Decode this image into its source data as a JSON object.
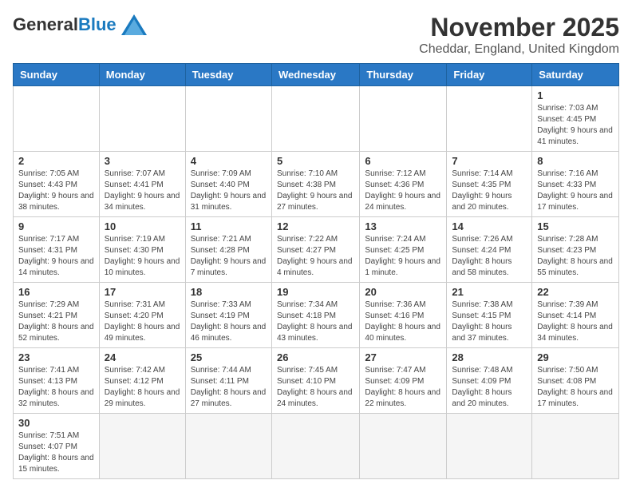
{
  "header": {
    "logo_general": "General",
    "logo_blue": "Blue",
    "month_title": "November 2025",
    "location": "Cheddar, England, United Kingdom"
  },
  "weekdays": [
    "Sunday",
    "Monday",
    "Tuesday",
    "Wednesday",
    "Thursday",
    "Friday",
    "Saturday"
  ],
  "weeks": [
    [
      {
        "day": "",
        "info": ""
      },
      {
        "day": "",
        "info": ""
      },
      {
        "day": "",
        "info": ""
      },
      {
        "day": "",
        "info": ""
      },
      {
        "day": "",
        "info": ""
      },
      {
        "day": "",
        "info": ""
      },
      {
        "day": "1",
        "info": "Sunrise: 7:03 AM\nSunset: 4:45 PM\nDaylight: 9 hours and 41 minutes."
      }
    ],
    [
      {
        "day": "2",
        "info": "Sunrise: 7:05 AM\nSunset: 4:43 PM\nDaylight: 9 hours and 38 minutes."
      },
      {
        "day": "3",
        "info": "Sunrise: 7:07 AM\nSunset: 4:41 PM\nDaylight: 9 hours and 34 minutes."
      },
      {
        "day": "4",
        "info": "Sunrise: 7:09 AM\nSunset: 4:40 PM\nDaylight: 9 hours and 31 minutes."
      },
      {
        "day": "5",
        "info": "Sunrise: 7:10 AM\nSunset: 4:38 PM\nDaylight: 9 hours and 27 minutes."
      },
      {
        "day": "6",
        "info": "Sunrise: 7:12 AM\nSunset: 4:36 PM\nDaylight: 9 hours and 24 minutes."
      },
      {
        "day": "7",
        "info": "Sunrise: 7:14 AM\nSunset: 4:35 PM\nDaylight: 9 hours and 20 minutes."
      },
      {
        "day": "8",
        "info": "Sunrise: 7:16 AM\nSunset: 4:33 PM\nDaylight: 9 hours and 17 minutes."
      }
    ],
    [
      {
        "day": "9",
        "info": "Sunrise: 7:17 AM\nSunset: 4:31 PM\nDaylight: 9 hours and 14 minutes."
      },
      {
        "day": "10",
        "info": "Sunrise: 7:19 AM\nSunset: 4:30 PM\nDaylight: 9 hours and 10 minutes."
      },
      {
        "day": "11",
        "info": "Sunrise: 7:21 AM\nSunset: 4:28 PM\nDaylight: 9 hours and 7 minutes."
      },
      {
        "day": "12",
        "info": "Sunrise: 7:22 AM\nSunset: 4:27 PM\nDaylight: 9 hours and 4 minutes."
      },
      {
        "day": "13",
        "info": "Sunrise: 7:24 AM\nSunset: 4:25 PM\nDaylight: 9 hours and 1 minute."
      },
      {
        "day": "14",
        "info": "Sunrise: 7:26 AM\nSunset: 4:24 PM\nDaylight: 8 hours and 58 minutes."
      },
      {
        "day": "15",
        "info": "Sunrise: 7:28 AM\nSunset: 4:23 PM\nDaylight: 8 hours and 55 minutes."
      }
    ],
    [
      {
        "day": "16",
        "info": "Sunrise: 7:29 AM\nSunset: 4:21 PM\nDaylight: 8 hours and 52 minutes."
      },
      {
        "day": "17",
        "info": "Sunrise: 7:31 AM\nSunset: 4:20 PM\nDaylight: 8 hours and 49 minutes."
      },
      {
        "day": "18",
        "info": "Sunrise: 7:33 AM\nSunset: 4:19 PM\nDaylight: 8 hours and 46 minutes."
      },
      {
        "day": "19",
        "info": "Sunrise: 7:34 AM\nSunset: 4:18 PM\nDaylight: 8 hours and 43 minutes."
      },
      {
        "day": "20",
        "info": "Sunrise: 7:36 AM\nSunset: 4:16 PM\nDaylight: 8 hours and 40 minutes."
      },
      {
        "day": "21",
        "info": "Sunrise: 7:38 AM\nSunset: 4:15 PM\nDaylight: 8 hours and 37 minutes."
      },
      {
        "day": "22",
        "info": "Sunrise: 7:39 AM\nSunset: 4:14 PM\nDaylight: 8 hours and 34 minutes."
      }
    ],
    [
      {
        "day": "23",
        "info": "Sunrise: 7:41 AM\nSunset: 4:13 PM\nDaylight: 8 hours and 32 minutes."
      },
      {
        "day": "24",
        "info": "Sunrise: 7:42 AM\nSunset: 4:12 PM\nDaylight: 8 hours and 29 minutes."
      },
      {
        "day": "25",
        "info": "Sunrise: 7:44 AM\nSunset: 4:11 PM\nDaylight: 8 hours and 27 minutes."
      },
      {
        "day": "26",
        "info": "Sunrise: 7:45 AM\nSunset: 4:10 PM\nDaylight: 8 hours and 24 minutes."
      },
      {
        "day": "27",
        "info": "Sunrise: 7:47 AM\nSunset: 4:09 PM\nDaylight: 8 hours and 22 minutes."
      },
      {
        "day": "28",
        "info": "Sunrise: 7:48 AM\nSunset: 4:09 PM\nDaylight: 8 hours and 20 minutes."
      },
      {
        "day": "29",
        "info": "Sunrise: 7:50 AM\nSunset: 4:08 PM\nDaylight: 8 hours and 17 minutes."
      }
    ],
    [
      {
        "day": "30",
        "info": "Sunrise: 7:51 AM\nSunset: 4:07 PM\nDaylight: 8 hours and 15 minutes."
      },
      {
        "day": "",
        "info": ""
      },
      {
        "day": "",
        "info": ""
      },
      {
        "day": "",
        "info": ""
      },
      {
        "day": "",
        "info": ""
      },
      {
        "day": "",
        "info": ""
      },
      {
        "day": "",
        "info": ""
      }
    ]
  ]
}
